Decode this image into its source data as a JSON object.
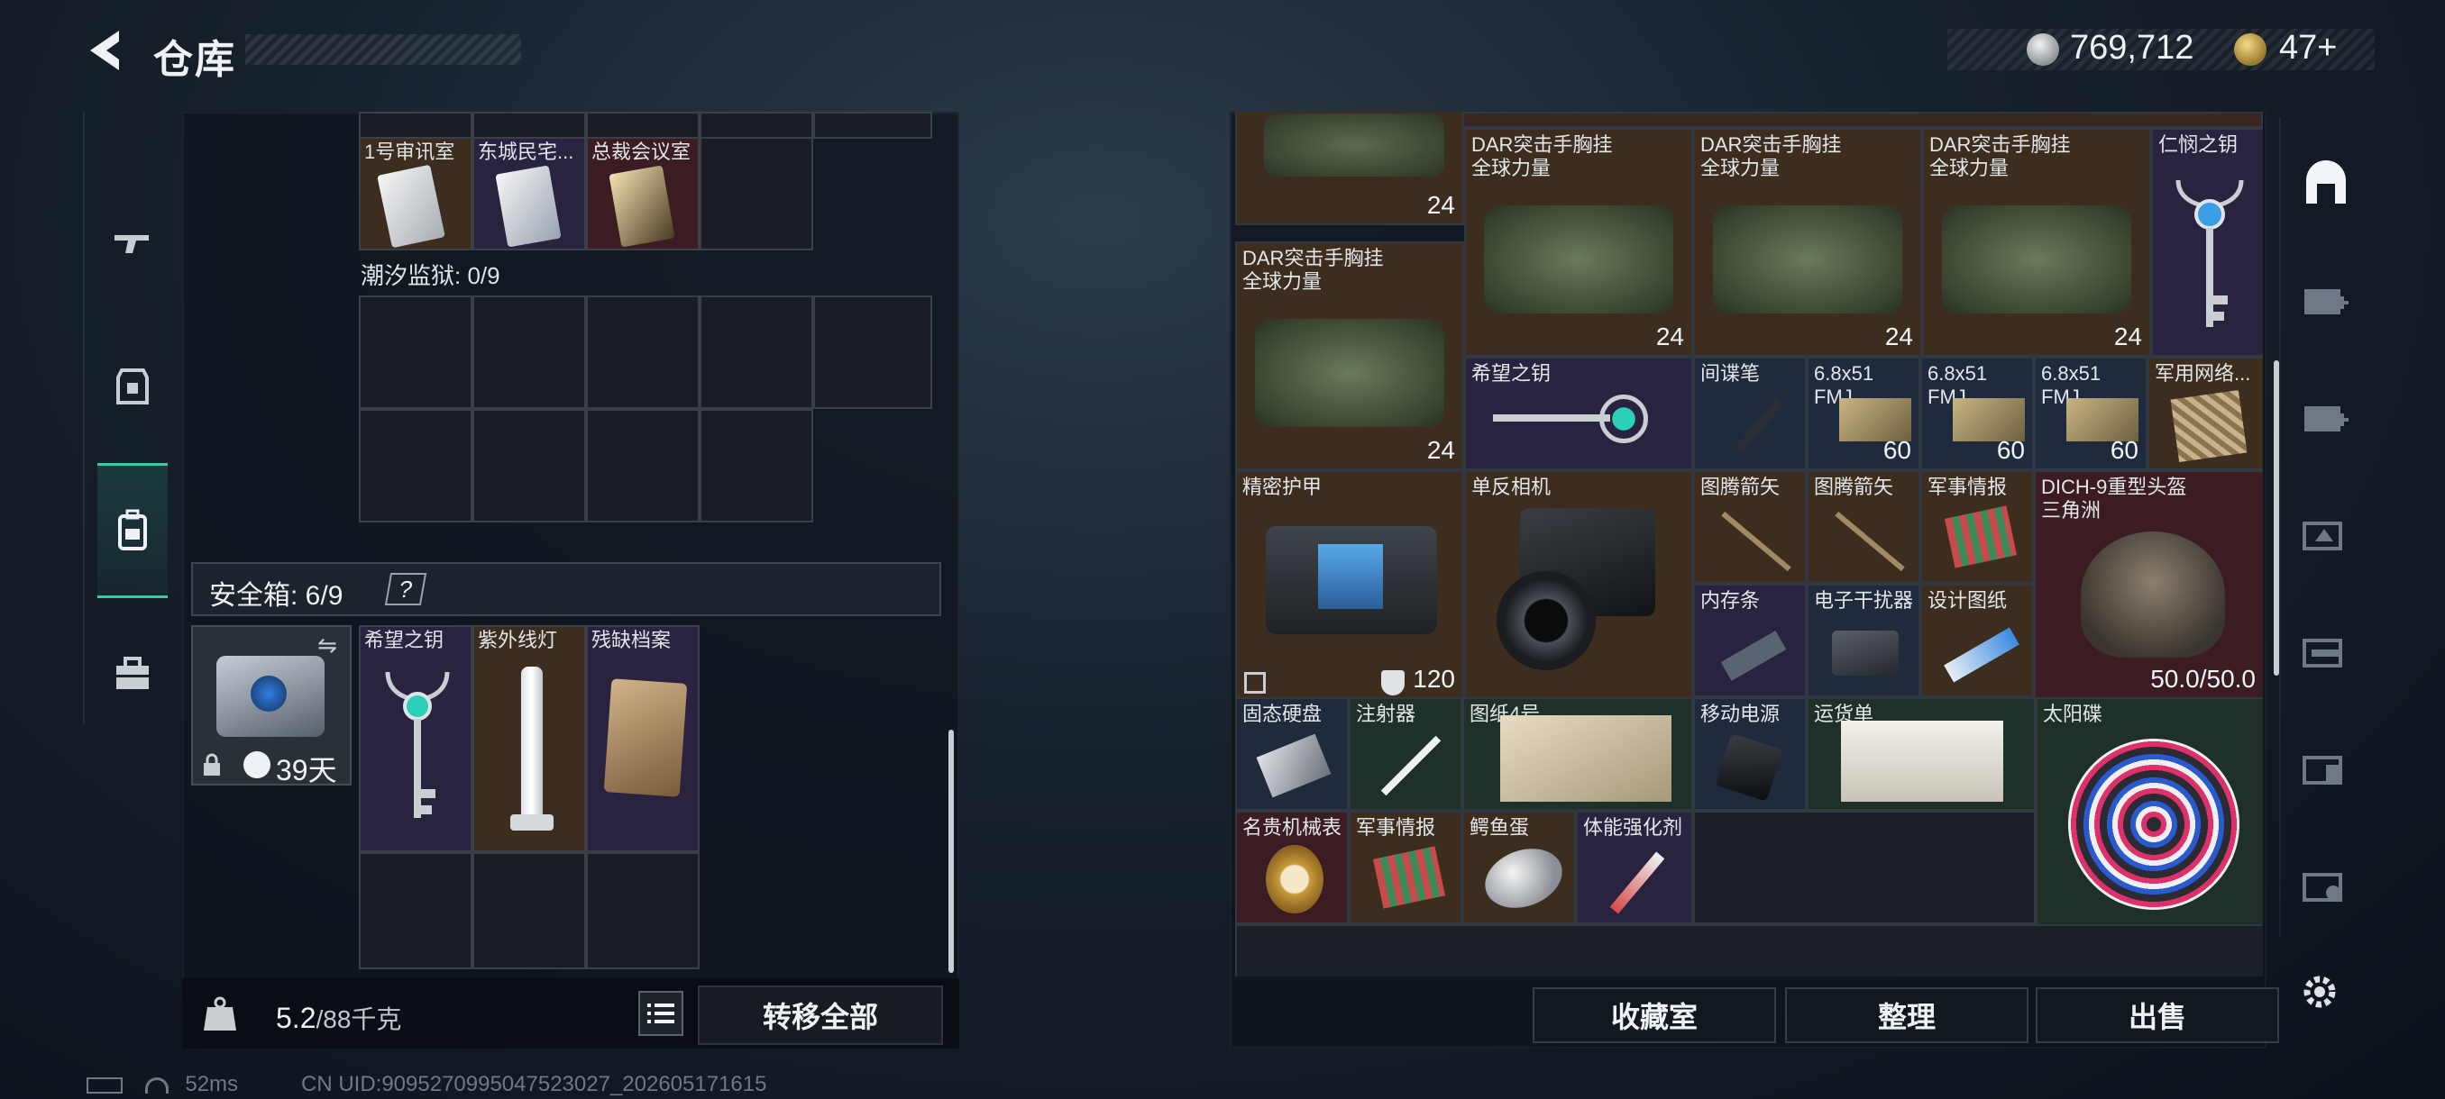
{
  "header": {
    "title": "仓库",
    "silver_amount": "769,712",
    "gold_amount": "47+"
  },
  "left_nav": [
    "weapon",
    "armor",
    "backpack",
    "case"
  ],
  "left_panel": {
    "top_row_labels": [
      "1号审讯室",
      "东城民宅...",
      "总裁会议室"
    ],
    "prison_label": "潮汐监狱: 0/9",
    "safebox_label": "安全箱: 6/9",
    "help_mark": "?",
    "safebox_days": "39天",
    "safe_items": [
      {
        "label": "希望之钥"
      },
      {
        "label": "紫外线灯"
      },
      {
        "label": "残缺档案"
      }
    ],
    "weight_value": "5.2",
    "weight_max": "/88千克",
    "transfer_all": "转移全部"
  },
  "right_grid": {
    "row1_labels": [
      "DAR突击手胸挂\n全球力量",
      "DAR突击手胸挂\n全球力量",
      "DAR突击手胸挂\n全球力量",
      "仁悯之钥"
    ],
    "row1_qty": [
      "24",
      "24",
      "24"
    ],
    "top_left_qty": "24",
    "big_bag_label": "DAR突击手胸挂\n全球力量",
    "big_bag_qty": "24",
    "key2_label": "希望之钥",
    "spy_pen": "间谍笔",
    "ammo_label": "6.8x51\nFMJ",
    "ammo_qty": "60",
    "net_label": "军用网络...",
    "armor_label": "精密护甲",
    "armor_value": "120",
    "camera_label": "单反相机",
    "arrow_label": "图腾箭矢",
    "intel_label": "军事情报",
    "helmet_label": "DICH-9重型头盔\n三角洲",
    "helmet_dur": "50.0/50.0",
    "ram_label": "内存条",
    "jammer_label": "电子干扰器",
    "blueprint_label": "设计图纸",
    "ssd_label": "固态硬盘",
    "syringe_label": "注射器",
    "drawing_label": "图纸4号",
    "powerbank_label": "移动电源",
    "waybill_label": "运货单",
    "sundisk_label": "太阳碟",
    "watch_label": "名贵机械表",
    "intel2_label": "军事情报",
    "croc_egg_label": "鳄鱼蛋",
    "stim_label": "体能强化剂"
  },
  "actions": {
    "collection": "收藏室",
    "sort": "整理",
    "sell": "出售"
  },
  "status": {
    "ping": "52ms",
    "uid": "CN UID:9095270995047523027_202605171615"
  },
  "colors": {
    "accent": "#3bc9a8",
    "rare_red": "#3a1c22",
    "rare_gold": "#3d2d1f",
    "rare_blue": "#1f2a3d",
    "rare_purple": "#2a2340"
  }
}
